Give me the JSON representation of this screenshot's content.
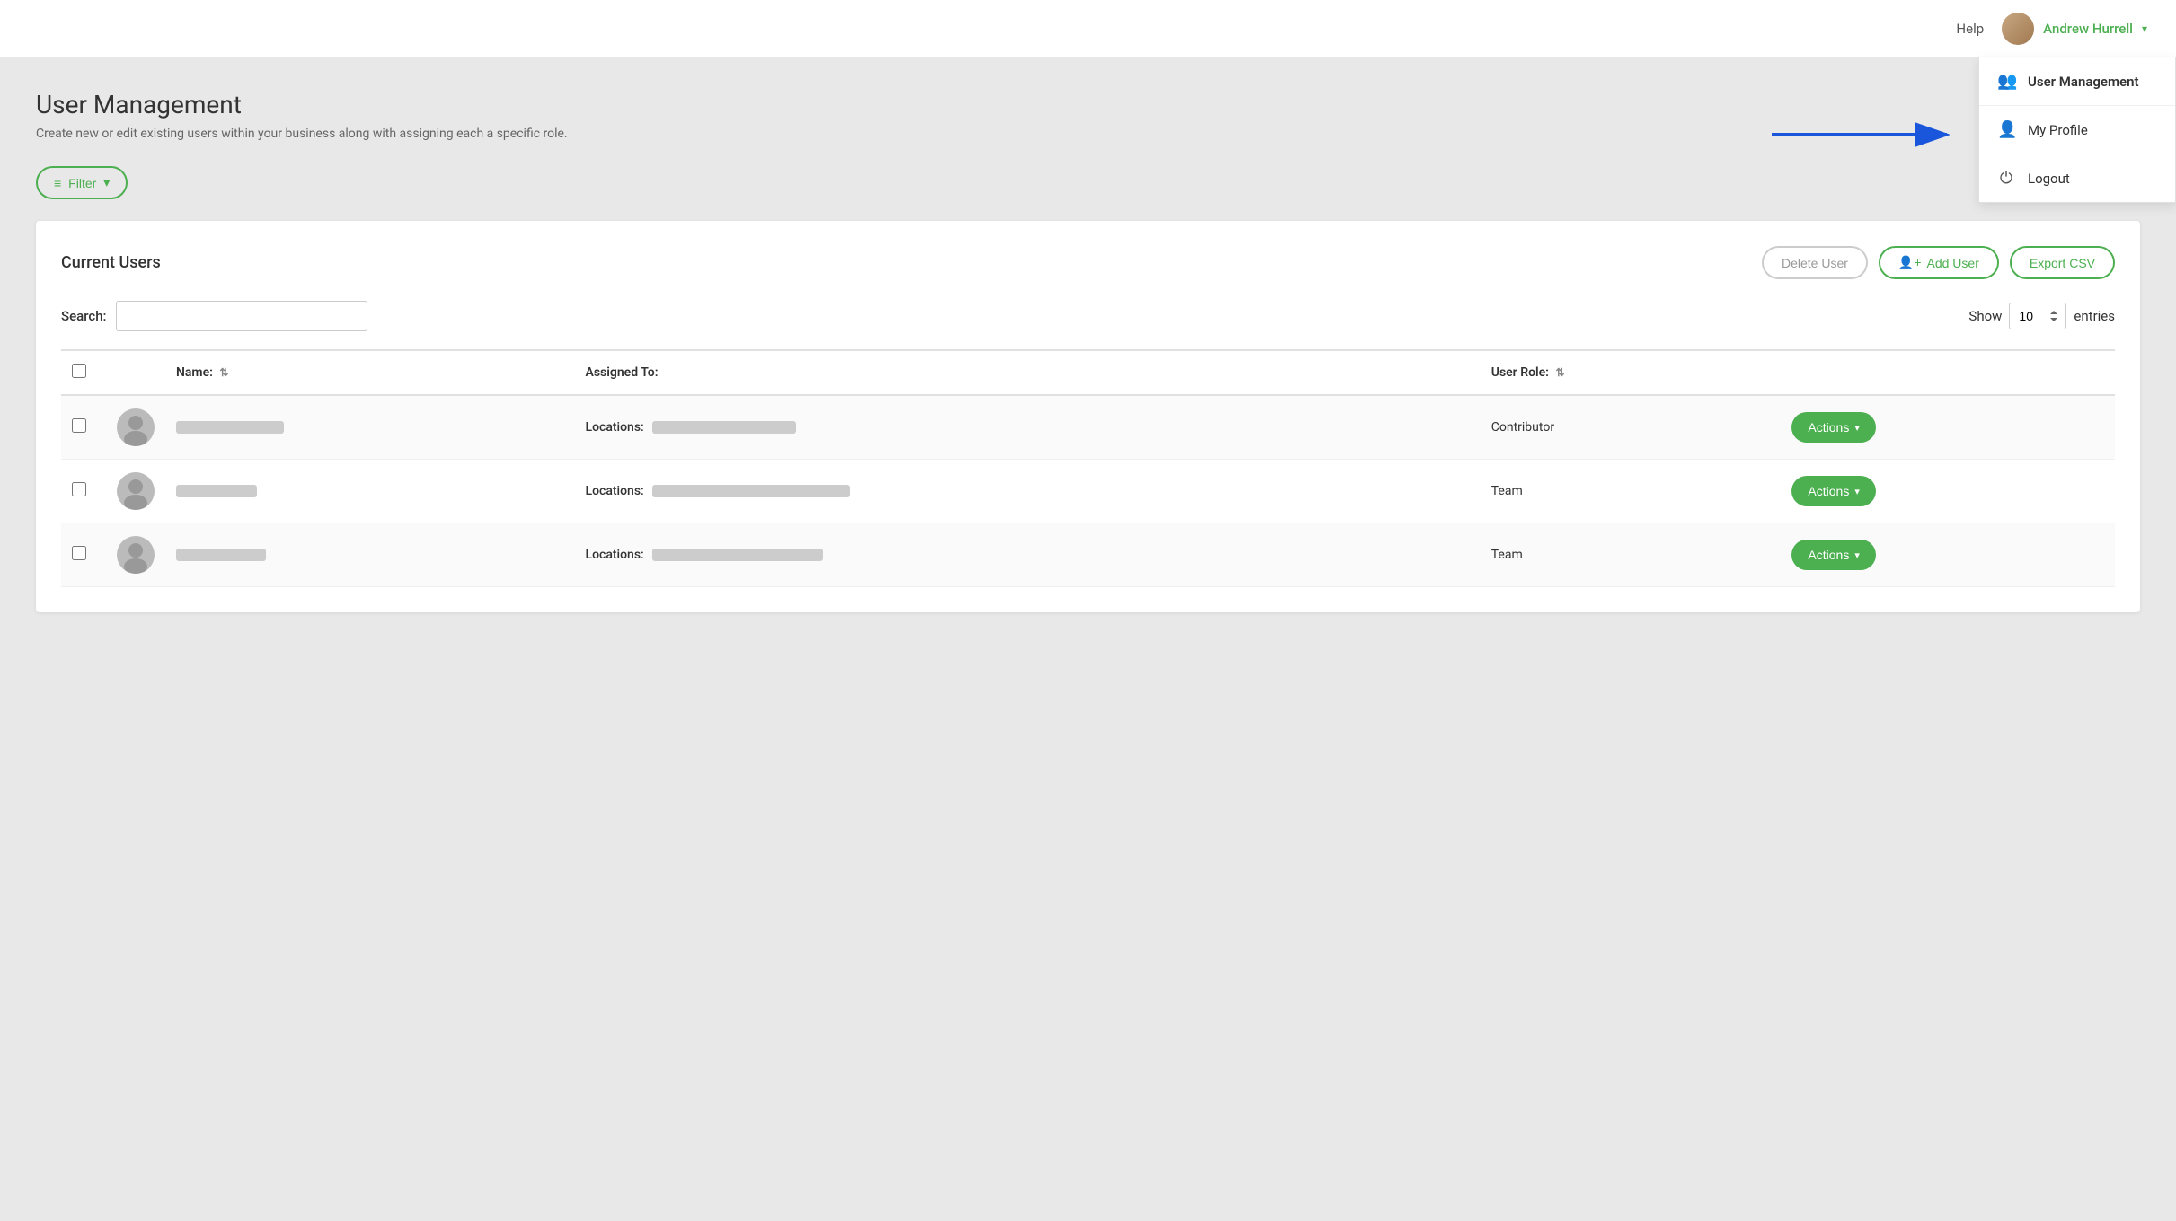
{
  "topnav": {
    "help_label": "Help",
    "user_name": "Andrew Hurrell",
    "chevron": "▾"
  },
  "dropdown": {
    "items": [
      {
        "id": "user-management",
        "icon": "👥",
        "label": "User Management",
        "active": true
      },
      {
        "id": "my-profile",
        "icon": "👤",
        "label": "My Profile",
        "active": false
      },
      {
        "id": "logout",
        "icon": "⏻",
        "label": "Logout",
        "active": false
      }
    ]
  },
  "page": {
    "title": "User Management",
    "subtitle": "Create new or edit existing users within your business along with assigning each a specific role.",
    "filter_btn": "Filter"
  },
  "table_card": {
    "title": "Current Users",
    "delete_btn": "Delete User",
    "add_btn": "Add User",
    "export_btn": "Export CSV",
    "search_label": "Search:",
    "search_placeholder": "",
    "show_label": "Show",
    "show_value": "10",
    "entries_label": "entries",
    "columns": [
      {
        "id": "name",
        "label": "Name:",
        "sortable": true
      },
      {
        "id": "assigned_to",
        "label": "Assigned To:",
        "sortable": false
      },
      {
        "id": "user_role",
        "label": "User Role:",
        "sortable": true
      },
      {
        "id": "actions",
        "label": "",
        "sortable": false
      }
    ],
    "rows": [
      {
        "id": 1,
        "name_blur_width": 120,
        "assigned_label": "Locations:",
        "assigned_blur_width": 160,
        "role": "Contributor",
        "actions_btn": "Actions"
      },
      {
        "id": 2,
        "name_blur_width": 90,
        "assigned_label": "Locations:",
        "assigned_blur_width": 220,
        "role": "Team",
        "actions_btn": "Actions"
      },
      {
        "id": 3,
        "name_blur_width": 100,
        "assigned_label": "Locations:",
        "assigned_blur_width": 190,
        "role": "Team",
        "actions_btn": "Actions"
      }
    ]
  },
  "colors": {
    "green": "#4CAF50",
    "blue_arrow": "#1a56db"
  }
}
